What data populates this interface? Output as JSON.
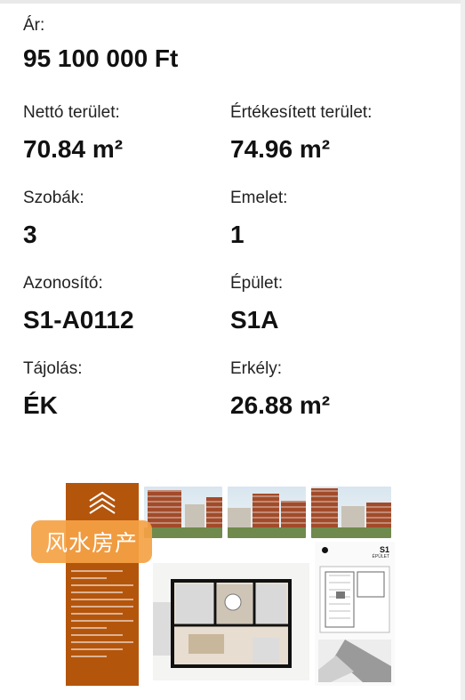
{
  "price": {
    "label": "Ár:",
    "value": "95 100 000 Ft"
  },
  "details": [
    {
      "label": "Nettó terület:",
      "value": "70.84 m²"
    },
    {
      "label": "Értékesített terület:",
      "value": "74.96 m²"
    },
    {
      "label": "Szobák:",
      "value": "3"
    },
    {
      "label": "Emelet:",
      "value": "1"
    },
    {
      "label": "Azonosító:",
      "value": "S1-A0112"
    },
    {
      "label": "Épület:",
      "value": "S1A"
    },
    {
      "label": "Tájolás:",
      "value": "ÉK"
    },
    {
      "label": "Erkély:",
      "value": "26.88 m²"
    }
  ],
  "promo": {
    "plan_tag": "S1",
    "plan_subtag": "ÉPÜLET",
    "brand_color": "#b4550c",
    "watermark": "风水房产"
  }
}
